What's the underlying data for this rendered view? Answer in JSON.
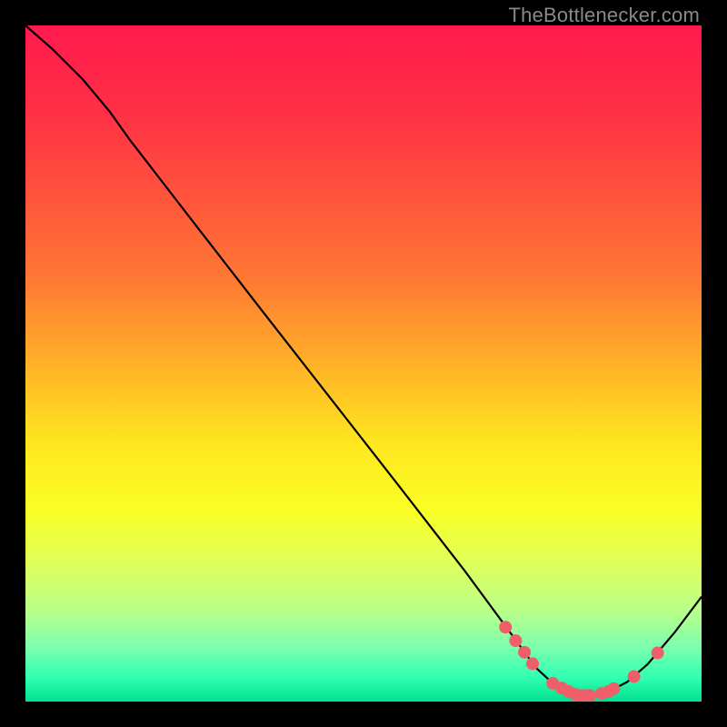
{
  "watermark": "TheBottlenecker.com",
  "chart_data": {
    "type": "line",
    "title": "",
    "xlabel": "",
    "ylabel": "",
    "xlim": [
      0,
      100
    ],
    "ylim": [
      0,
      100
    ],
    "background_gradient": {
      "stops": [
        {
          "offset": 0.0,
          "color": "#ff1a4d"
        },
        {
          "offset": 0.12,
          "color": "#ff2e46"
        },
        {
          "offset": 0.25,
          "color": "#ff533c"
        },
        {
          "offset": 0.38,
          "color": "#ff7a33"
        },
        {
          "offset": 0.5,
          "color": "#ffb128"
        },
        {
          "offset": 0.62,
          "color": "#ffe71f"
        },
        {
          "offset": 0.72,
          "color": "#f9ff26"
        },
        {
          "offset": 0.8,
          "color": "#ddff5e"
        },
        {
          "offset": 0.87,
          "color": "#b6ff8c"
        },
        {
          "offset": 0.92,
          "color": "#7bffae"
        },
        {
          "offset": 0.965,
          "color": "#30ffb2"
        },
        {
          "offset": 1.0,
          "color": "#00e08e"
        }
      ]
    },
    "curve": [
      {
        "x": 0.0,
        "y": 100.0
      },
      {
        "x": 4.0,
        "y": 96.5
      },
      {
        "x": 8.5,
        "y": 92.0
      },
      {
        "x": 12.5,
        "y": 87.2
      },
      {
        "x": 15.5,
        "y": 83.0
      },
      {
        "x": 25.0,
        "y": 70.7
      },
      {
        "x": 35.0,
        "y": 57.8
      },
      {
        "x": 45.0,
        "y": 45.0
      },
      {
        "x": 55.0,
        "y": 32.2
      },
      {
        "x": 65.0,
        "y": 19.3
      },
      {
        "x": 72.0,
        "y": 9.8
      },
      {
        "x": 75.5,
        "y": 5.0
      },
      {
        "x": 78.0,
        "y": 2.7
      },
      {
        "x": 80.5,
        "y": 1.4
      },
      {
        "x": 83.0,
        "y": 0.9
      },
      {
        "x": 86.5,
        "y": 1.6
      },
      {
        "x": 89.0,
        "y": 2.9
      },
      {
        "x": 92.0,
        "y": 5.5
      },
      {
        "x": 96.0,
        "y": 10.2
      },
      {
        "x": 100.0,
        "y": 15.5
      }
    ],
    "markers": [
      {
        "x": 71.0,
        "y": 11.0
      },
      {
        "x": 72.5,
        "y": 9.0
      },
      {
        "x": 73.8,
        "y": 7.3
      },
      {
        "x": 75.0,
        "y": 5.6
      },
      {
        "x": 78.0,
        "y": 2.7
      },
      {
        "x": 79.3,
        "y": 2.0
      },
      {
        "x": 80.3,
        "y": 1.5
      },
      {
        "x": 81.2,
        "y": 1.1
      },
      {
        "x": 82.0,
        "y": 0.9
      },
      {
        "x": 82.8,
        "y": 0.9
      },
      {
        "x": 83.5,
        "y": 0.9
      },
      {
        "x": 85.2,
        "y": 1.2
      },
      {
        "x": 86.3,
        "y": 1.5
      },
      {
        "x": 87.0,
        "y": 1.9
      },
      {
        "x": 90.0,
        "y": 3.7
      },
      {
        "x": 93.5,
        "y": 7.2
      }
    ],
    "marker_color": "#ef5f69",
    "curve_color": "#000000"
  }
}
